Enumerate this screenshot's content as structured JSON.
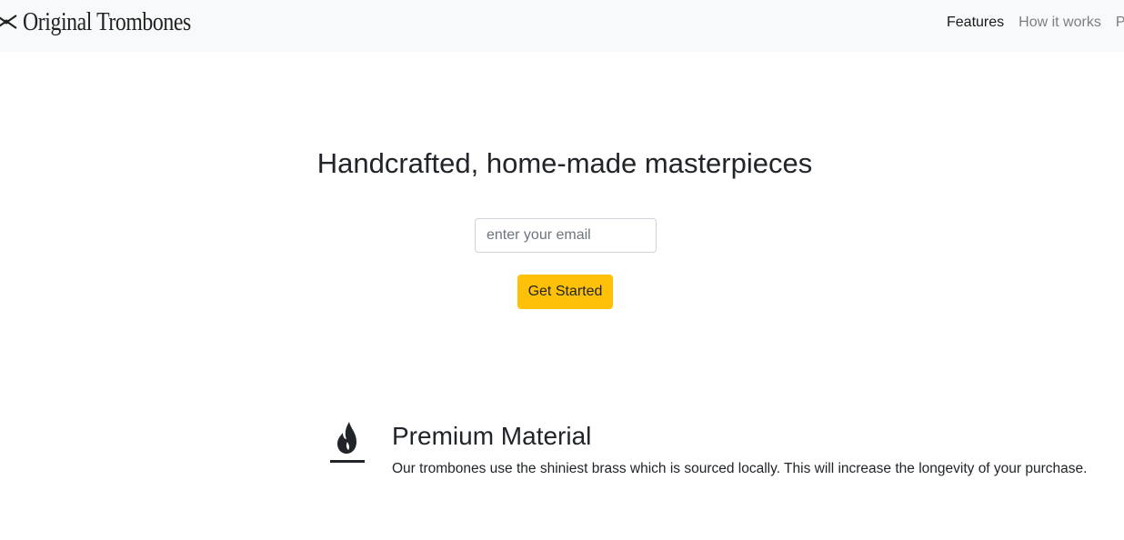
{
  "navbar": {
    "brand": {
      "name": "Original Trombones",
      "logo_icon": "trombone-logo-icon"
    },
    "links": [
      {
        "label": "Features",
        "active": true
      },
      {
        "label": "How it works",
        "active": false
      },
      {
        "label": "Pr",
        "active": false
      }
    ]
  },
  "hero": {
    "title": "Handcrafted, home-made masterpieces",
    "email_placeholder": "enter your email",
    "cta_label": "Get Started",
    "cta_color": "#ffc107"
  },
  "features": [
    {
      "icon": "flame-icon",
      "title": "Premium Material",
      "description": "Our trombones use the shiniest brass which is sourced locally. This will increase the longevity of your purchase."
    }
  ]
}
